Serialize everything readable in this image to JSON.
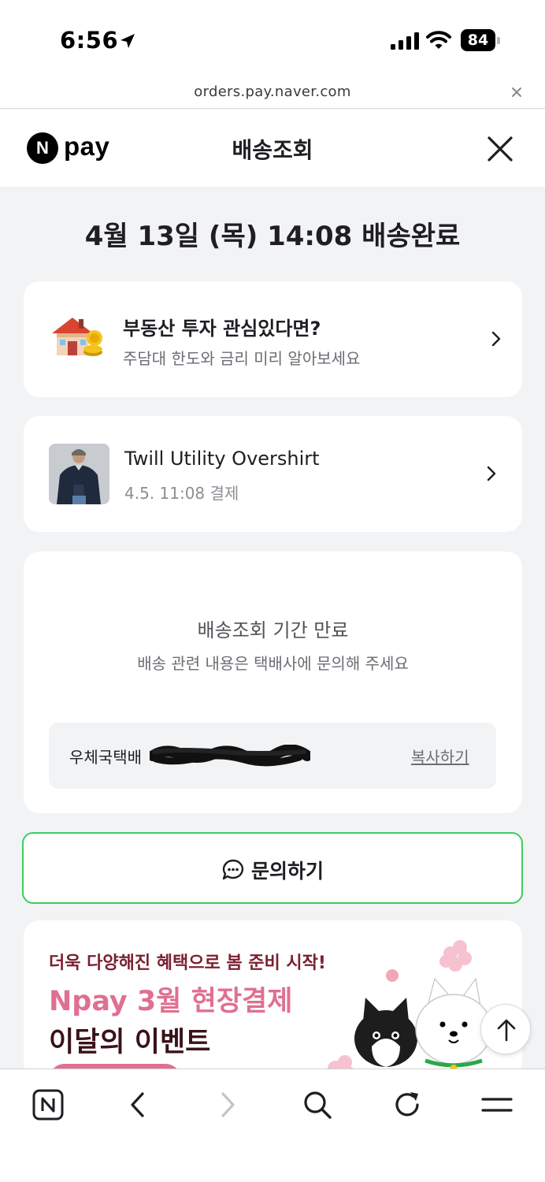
{
  "status_bar": {
    "time": "6:56",
    "battery": "84"
  },
  "url_bar": {
    "url": "orders.pay.naver.com"
  },
  "header": {
    "logo_n": "N",
    "logo_text": "pay",
    "title": "배송조회"
  },
  "delivery": {
    "status": "4월 13일 (목) 14:08 배송완료"
  },
  "ad_card": {
    "title": "부동산 투자 관심있다면?",
    "subtitle": "주담대 한도와 금리 미리 알아보세요"
  },
  "product": {
    "name": "Twill Utility Overshirt",
    "payment_date": "4.5. 11:08 결제"
  },
  "tracking": {
    "title": "배송조회 기간 만료",
    "subtitle": "배송 관련 내용은 택배사에 문의해 주세요",
    "carrier": "우체국택배",
    "copy_label": "복사하기"
  },
  "inquiry": {
    "label": "문의하기"
  },
  "promo": {
    "line1": "더욱 다양해진 혜택으로 봄 준비 시작!",
    "line2": "Npay 3월 현장결제",
    "line3": "이달의 이벤트"
  },
  "colors": {
    "brand_green": "#3dcd5e",
    "promo_pink": "#e0708f",
    "background": "#f2f3f5"
  },
  "icons": {
    "bottom_bar": [
      "naver-home-icon",
      "back-icon",
      "forward-icon",
      "search-icon",
      "reload-icon",
      "menu-icon"
    ]
  }
}
